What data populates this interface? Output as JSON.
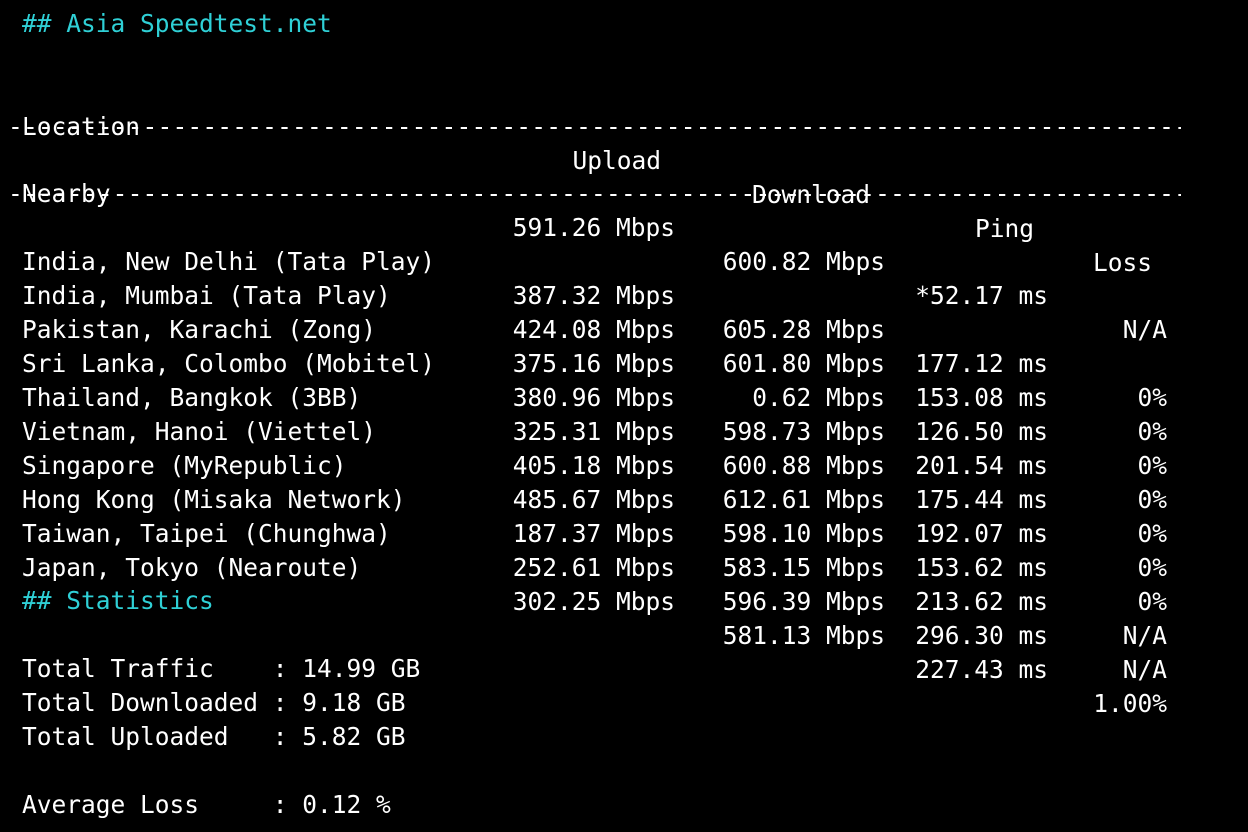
{
  "asia_heading": "## Asia Speedtest.net",
  "columns": {
    "location": "Location",
    "upload": "Upload",
    "download": "Download",
    "ping": "Ping",
    "loss": "Loss"
  },
  "separator": "-----------------------------------------------------------------------------------------------------------",
  "nearby": {
    "location": "Nearby",
    "upload": "591.26 Mbps",
    "download": "600.82 Mbps",
    "ping": "*52.17 ms",
    "loss": "N/A"
  },
  "rows": [
    {
      "location": "India, New Delhi (Tata Play)",
      "upload": "387.32 Mbps",
      "download": "605.28 Mbps",
      "ping": "177.12 ms",
      "loss": "0%"
    },
    {
      "location": "India, Mumbai (Tata Play)",
      "upload": "424.08 Mbps",
      "download": "601.80 Mbps",
      "ping": "153.08 ms",
      "loss": "0%"
    },
    {
      "location": "Pakistan, Karachi (Zong)",
      "upload": "375.16 Mbps",
      "download": "0.62 Mbps",
      "ping": "126.50 ms",
      "loss": "0%"
    },
    {
      "location": "Sri Lanka, Colombo (Mobitel)",
      "upload": "380.96 Mbps",
      "download": "598.73 Mbps",
      "ping": "201.54 ms",
      "loss": "0%"
    },
    {
      "location": "Thailand, Bangkok (3BB)",
      "upload": "325.31 Mbps",
      "download": "600.88 Mbps",
      "ping": "175.44 ms",
      "loss": "0%"
    },
    {
      "location": "Vietnam, Hanoi (Viettel)",
      "upload": "405.18 Mbps",
      "download": "612.61 Mbps",
      "ping": "192.07 ms",
      "loss": "0%"
    },
    {
      "location": "Singapore (MyRepublic)",
      "upload": "485.67 Mbps",
      "download": "598.10 Mbps",
      "ping": "153.62 ms",
      "loss": "0%"
    },
    {
      "location": "Hong Kong (Misaka Network)",
      "upload": "187.37 Mbps",
      "download": "583.15 Mbps",
      "ping": "213.62 ms",
      "loss": "N/A"
    },
    {
      "location": "Taiwan, Taipei (Chunghwa)",
      "upload": "252.61 Mbps",
      "download": "596.39 Mbps",
      "ping": "296.30 ms",
      "loss": "N/A"
    },
    {
      "location": "Japan, Tokyo (Nearoute)",
      "upload": "302.25 Mbps",
      "download": "581.13 Mbps",
      "ping": "227.43 ms",
      "loss": "1.00%"
    }
  ],
  "stats_heading": "## Statistics",
  "stats": {
    "total_traffic": "Total Traffic    : 14.99 GB",
    "total_downloaded": "Total Downloaded : 9.18 GB",
    "total_uploaded": "Total Uploaded   : 5.82 GB",
    "average_loss": "Average Loss     : 0.12 %"
  },
  "colors": {
    "background": "#000000",
    "text": "#ffffff",
    "heading": "#2fd0d6"
  }
}
